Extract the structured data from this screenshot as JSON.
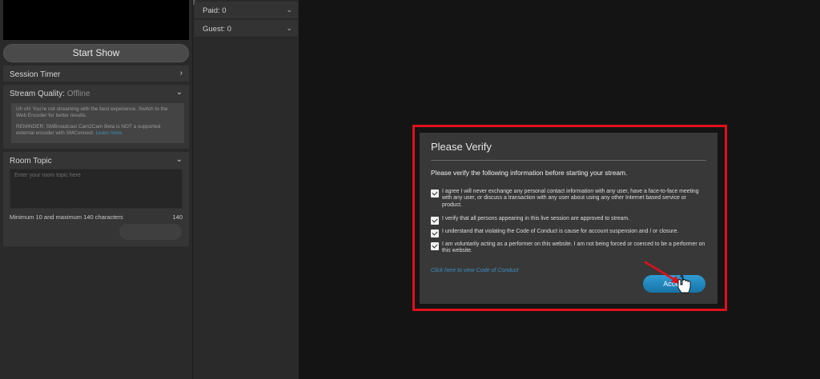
{
  "left_panel": {
    "start_show_label": "Start Show",
    "session_timer_label": "Session Timer",
    "stream_quality": {
      "label": "Stream Quality:",
      "status": "Offline",
      "note_line1": "Uh oh! You're not streaming with the best experience. Switch to the Web Encoder for better results.",
      "note_line2": "REMINDER: SMBroadcast Cam2Cam Beta is NOT a supported external encoder with SMConnect.",
      "learn_more": "Learn more"
    },
    "room_topic": {
      "label": "Room Topic",
      "placeholder": "Enter your room topic here",
      "limit_text": "Minimum 10 and maximum 140 characters",
      "char_count": "140"
    }
  },
  "middle_col": {
    "paid_label": "Paid: 0",
    "guest_label": "Guest: 0"
  },
  "modal": {
    "title": "Please Verify",
    "intro": "Please verify the following information before starting your stream.",
    "checks": [
      {
        "text": "I agree I will never exchange any personal contact information with any user, have a face-to-face meeting with any user, or discuss a transaction with any user about using any other Internet based service or product.",
        "checked": true
      },
      {
        "text": "I verify that all persons appearing in this live session are approved to stream.",
        "checked": true
      },
      {
        "text": "I understand that violating the Code of Conduct is cause for account suspension and / or closure.",
        "checked": true
      },
      {
        "text": "I am voluntarily acting as a performer on this website. I am not being forced or coerced to be a performer on this website.",
        "checked": true
      }
    ],
    "coc_link": "Click here to view Code of Conduct",
    "accept_label": "Accept"
  },
  "colors": {
    "accent_blue": "#2f9cd4",
    "highlight_red": "#e0101c",
    "modal_bg": "#383838",
    "page_bg": "#141414"
  }
}
